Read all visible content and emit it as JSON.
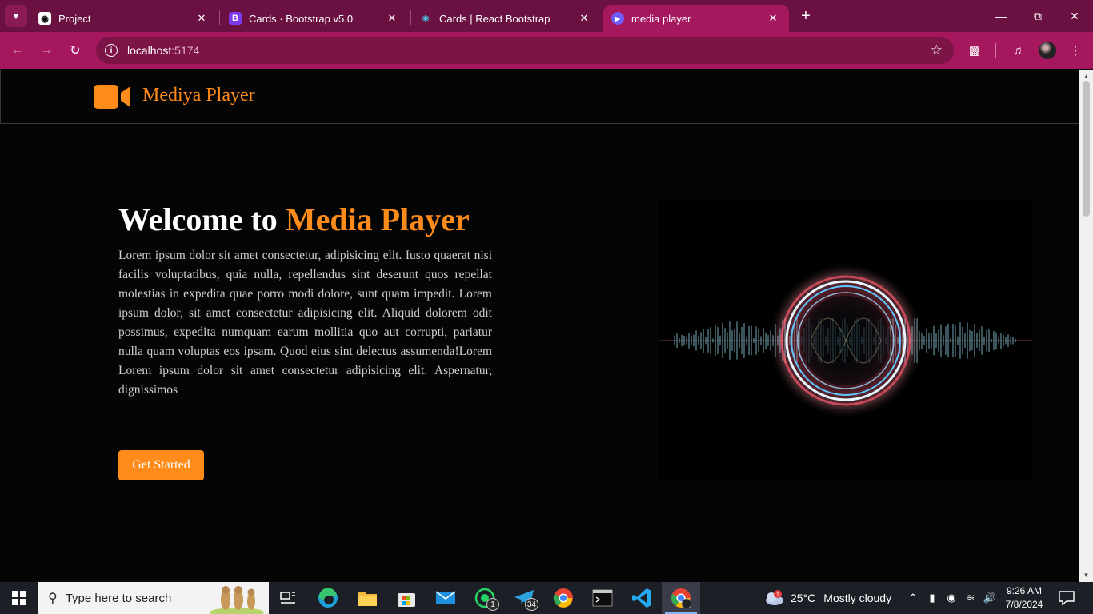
{
  "browser": {
    "tabs": [
      {
        "title": "Project",
        "icon": "github-icon"
      },
      {
        "title": "Cards · Bootstrap v5.0",
        "icon": "bootstrap-icon"
      },
      {
        "title": "Cards | React Bootstrap",
        "icon": "react-bootstrap-icon"
      },
      {
        "title": "media player",
        "icon": "play-circle-icon",
        "active": true
      }
    ],
    "address": {
      "host": "localhost",
      "port": ":5174"
    },
    "theme_color": "#a5185e"
  },
  "site": {
    "brand": "Mediya Player",
    "accent_color": "#ff8c1a",
    "hero": {
      "title_prefix": "Welcome to ",
      "title_accent": "Media Player",
      "body": "Lorem ipsum dolor sit amet consectetur, adipisicing elit. Iusto quaerat nisi facilis voluptatibus, quia nulla, repellendus sint deserunt quos repellat molestias in expedita quae porro modi dolore, sunt quam impedit. Lorem ipsum dolor, sit amet consectetur adipisicing elit. Aliquid dolorem odit possimus, expedita numquam earum mollitia quo aut corrupti, pariatur nulla quam voluptas eos ipsam. Quod eius sint delectus assumenda!Lorem Lorem ipsum dolor sit amet consectetur adipisicing elit. Aspernatur, dignissimos",
      "cta_label": "Get Started"
    }
  },
  "taskbar": {
    "search_placeholder": "Type here to search",
    "whatsapp_badge": "1",
    "telegram_badge": "34",
    "weather": {
      "temp": "25°C",
      "desc": "Mostly cloudy",
      "alert": "1"
    },
    "clock": {
      "time": "9:26 AM",
      "date": "7/8/2024"
    }
  }
}
